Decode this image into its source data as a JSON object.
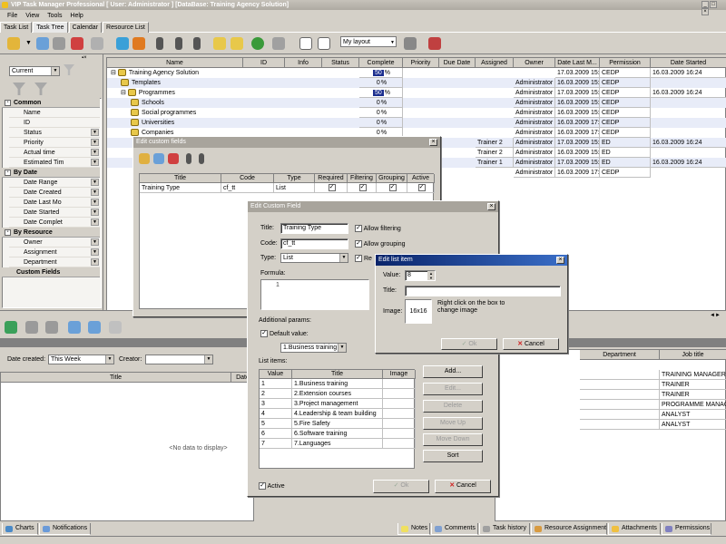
{
  "app": {
    "title": "VIP Task Manager Professional [ User: Administrator ] [DataBase: Training Agency Solution]"
  },
  "menu": [
    "File",
    "View",
    "Tools",
    "Help"
  ],
  "tabs": [
    "Task List",
    "Task Tree",
    "Calendar",
    "Resource List"
  ],
  "active_tab": "Task Tree",
  "toolbar": {
    "layout_select": "My layout"
  },
  "left_panel": {
    "filter_select": "Current",
    "groups": [
      {
        "title": "Common",
        "items": [
          "Name",
          "ID",
          "Status",
          "Priority",
          "Actual time",
          "Estimated Tim"
        ]
      },
      {
        "title": "By Date",
        "items": [
          "Date Range",
          "Date Created",
          "Date Last Mo",
          "Date Started",
          "Date Complet"
        ]
      },
      {
        "title": "By Resource",
        "items": [
          "Owner",
          "Assignment",
          "Department"
        ]
      },
      {
        "title": "Custom Fields",
        "items": []
      }
    ]
  },
  "grid": {
    "columns": [
      "Name",
      "ID",
      "Info",
      "Status",
      "Complete",
      "Priority",
      "Due Date",
      "Assigned",
      "Owner",
      "Date Last M...",
      "Permission",
      "Date Started"
    ],
    "rows": [
      {
        "name": "Training Agency Solution",
        "complete": "50",
        "owner": "",
        "last_mod": "17.03.2009 15:",
        "perm": "CEDP",
        "started": "16.03.2009 16:24",
        "assigned": ""
      },
      {
        "name": "Templates",
        "complete": "0",
        "owner": "Administrator",
        "last_mod": "16.03.2009 15:",
        "perm": "CEDP",
        "started": "",
        "assigned": ""
      },
      {
        "name": "Programmes",
        "complete": "50",
        "owner": "Administrator",
        "last_mod": "17.03.2009 15:",
        "perm": "CEDP",
        "started": "16.03.2009 16:24",
        "assigned": ""
      },
      {
        "name": "Schools",
        "complete": "0",
        "owner": "Administrator",
        "last_mod": "16.03.2009 15:",
        "perm": "CEDP",
        "started": "",
        "assigned": ""
      },
      {
        "name": "Social programmes",
        "complete": "0",
        "owner": "Administrator",
        "last_mod": "16.03.2009 15:",
        "perm": "CEDP",
        "started": "",
        "assigned": ""
      },
      {
        "name": "Universities",
        "complete": "0",
        "owner": "Administrator",
        "last_mod": "16.03.2009 17:",
        "perm": "CEDP",
        "started": "",
        "assigned": ""
      },
      {
        "name": "Companies",
        "complete": "0",
        "owner": "Administrator",
        "last_mod": "16.03.2009 17:",
        "perm": "CEDP",
        "started": "",
        "assigned": ""
      },
      {
        "name": "",
        "complete": "",
        "owner": "Administrator",
        "last_mod": "17.03.2009 15:",
        "perm": "ED",
        "started": "16.03.2009 16:24",
        "assigned": "Trainer 2"
      },
      {
        "name": "",
        "complete": "",
        "owner": "Administrator",
        "last_mod": "16.03.2009 15:",
        "perm": "ED",
        "started": "",
        "assigned": "Trainer 2"
      },
      {
        "name": "",
        "complete": "",
        "owner": "Administrator",
        "last_mod": "17.03.2009 15:",
        "perm": "ED",
        "started": "16.03.2009 16:24",
        "assigned": "Trainer 1"
      },
      {
        "name": "",
        "complete": "",
        "owner": "Administrator",
        "last_mod": "16.03.2009 17:",
        "perm": "CEDP",
        "started": "",
        "assigned": ""
      }
    ],
    "percent_sign": "%"
  },
  "bottom_left": {
    "date_created_label": "Date created:",
    "date_created_value": "This Week",
    "creator_label": "Creator:",
    "creator_value": "",
    "columns": [
      "Title",
      "Date"
    ],
    "empty": "<No data to display>",
    "tabs": [
      "Charts",
      "Notifications"
    ]
  },
  "bottom_right": {
    "columns": [
      "Department",
      "Job title"
    ],
    "job_titles": [
      "TRAINING MANAGER",
      "TRAINER",
      "TRAINER",
      "PROGRAMME MANAGE",
      "ANALYST",
      "ANALYST"
    ],
    "tabs": [
      "Notes",
      "Comments",
      "Task history",
      "Resource Assignment",
      "Attachments",
      "Permissions"
    ]
  },
  "edit_custom_fields": {
    "title": "Edit custom fields",
    "columns": [
      "Title",
      "Code",
      "Type",
      "Required",
      "Filtering",
      "Grouping",
      "Active"
    ],
    "rows": [
      {
        "title": "Training Type",
        "code": "cf_tt",
        "type": "List"
      }
    ]
  },
  "edit_custom_field": {
    "title": "Edit Custom Field",
    "title_label": "Title:",
    "title_value": "Training Type",
    "code_label": "Code:",
    "code_value": "cf_tt",
    "type_label": "Type:",
    "type_value": "List",
    "allow_filtering": "Allow filtering",
    "allow_grouping": "Allow grouping",
    "required_short": "Re",
    "formula_label": "Formula:",
    "formula_line": "1",
    "additional_params": "Additional params:",
    "default_value_label": "Default value:",
    "default_value": "1.Business training",
    "list_items_label": "List items:",
    "list_columns": [
      "Value",
      "Title",
      "Image"
    ],
    "list_items": [
      {
        "value": "1",
        "title": "1.Business training"
      },
      {
        "value": "2",
        "title": "2.Extension courses"
      },
      {
        "value": "3",
        "title": "3.Project management"
      },
      {
        "value": "4",
        "title": "4.Leadership & team building"
      },
      {
        "value": "5",
        "title": "5.Fire Safety"
      },
      {
        "value": "6",
        "title": "6.Software training"
      },
      {
        "value": "7",
        "title": "7.Languages"
      }
    ],
    "buttons": {
      "add": "Add...",
      "edit": "Edit...",
      "delete": "Delete",
      "move_up": "Move Up",
      "move_down": "Move Down",
      "sort": "Sort"
    },
    "active_label": "Active",
    "ok": "Ok",
    "cancel": "Cancel"
  },
  "edit_list_item": {
    "title": "Edit list item",
    "value_label": "Value:",
    "value": "8",
    "title_label": "Title:",
    "title_value": "",
    "image_label": "Image:",
    "image_box": "16x16",
    "hint": "Right click on the box to change image",
    "ok": "Ok",
    "cancel": "Cancel"
  },
  "colors": {
    "accent": "#0a246a",
    "selection": "#1c2f8f",
    "highlight_row": "#e8ecf8"
  }
}
